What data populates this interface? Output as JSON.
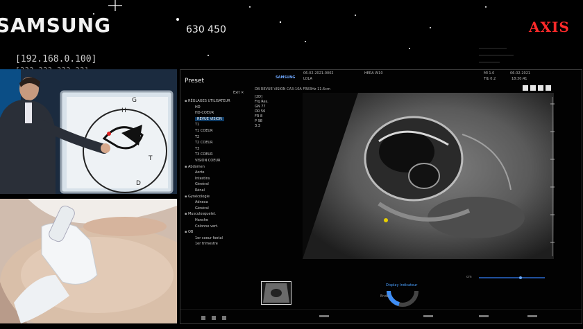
{
  "overlay": {
    "brand": "SAMSUNG",
    "counter": "630 450",
    "axis_logo": "AXIS",
    "ip_line1": "[192.168.0.100]",
    "ip_line2": "[??? ???.???.??]"
  },
  "camera_top": {
    "whiteboard_letters": [
      "G",
      "H",
      "T",
      "D"
    ]
  },
  "ultrasound": {
    "panel_title": "Preset",
    "exit_label": "Exit",
    "header": {
      "brand": "SAMSUNG",
      "date_id": "06-02-2021-0002",
      "patient": "LOLA",
      "probe": "HERA W10",
      "date_right": "06-02-2021",
      "time_right": "18:30:41",
      "mi": "MI 1.0",
      "tib": "TIb 0.2",
      "subheader": "DB REVUE VISION CA3-10A FR83Hz 11.6cm"
    },
    "params": [
      "[2D]",
      "Frq Res.",
      "GN 77",
      "DR 56",
      "FR 8",
      "P 98",
      "3.3"
    ],
    "tree": [
      {
        "label": "RÉGLAGES UTILISATEUR",
        "folder": true,
        "indent": 0
      },
      {
        "label": "HD",
        "indent": 1
      },
      {
        "label": "HD-COEUR",
        "indent": 1
      },
      {
        "label": "REVUE VISION",
        "indent": 1,
        "selected": true
      },
      {
        "label": "T1",
        "indent": 1
      },
      {
        "label": "T1 COEUR",
        "indent": 1
      },
      {
        "label": "T2",
        "indent": 1
      },
      {
        "label": "T2 COEUR",
        "indent": 1
      },
      {
        "label": "T3",
        "indent": 1
      },
      {
        "label": "T3 COEUR",
        "indent": 1
      },
      {
        "label": "VISION COEUR",
        "indent": 1
      },
      {
        "label": "Abdomen",
        "folder": true,
        "indent": 0
      },
      {
        "label": "Aorte",
        "indent": 1
      },
      {
        "label": "Intestins",
        "indent": 1
      },
      {
        "label": "Général",
        "indent": 1
      },
      {
        "label": "Rénal",
        "indent": 1
      },
      {
        "label": "Gynécologie",
        "folder": true,
        "indent": 0
      },
      {
        "label": "Adnexa",
        "indent": 1
      },
      {
        "label": "Général",
        "indent": 1
      },
      {
        "label": "Musculosquelet.",
        "folder": true,
        "indent": 0
      },
      {
        "label": "Hanche",
        "indent": 1
      },
      {
        "label": "Colonne vert.",
        "indent": 1
      },
      {
        "label": "OB",
        "folder": true,
        "indent": 0
      },
      {
        "label": "1er coeur foetal",
        "indent": 1
      },
      {
        "label": "1er trimestre",
        "indent": 1
      }
    ],
    "bottom": {
      "display_indicator": "Display Indicateur",
      "probe_label": "Endo",
      "unit_cm": "cm"
    }
  }
}
